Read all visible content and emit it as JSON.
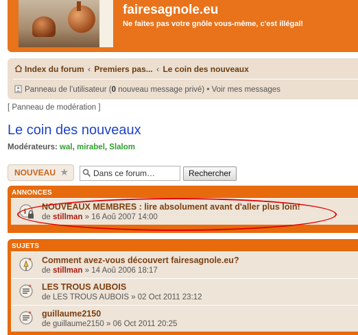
{
  "header": {
    "site_title": "fairesagnole.eu",
    "site_desc": "Ne faites pas votre gnôle vous-même, c'est illégal!"
  },
  "breadcrumbs": {
    "items": [
      "Index du forum",
      "Premiers pas...",
      "Le coin des nouveaux"
    ],
    "separator": "‹"
  },
  "userbar": {
    "panel": "Panneau de l’utilisateur (",
    "count": "0",
    "messages": " nouveau message privé)",
    "dot": "•",
    "view": "Voir mes messages"
  },
  "mod_panel": "[ Panneau de modération ]",
  "forum": {
    "title": "Le coin des nouveaux",
    "moderators_label": "Modérateurs: ",
    "moderators": [
      "wal",
      "mirabel",
      "Slalom"
    ]
  },
  "actions": {
    "new_topic": "NOUVEAU",
    "new_topic_star": "★",
    "search_value": "Dans ce forum…",
    "search_button": "Rechercher"
  },
  "announcements": {
    "header": "ANNONCES",
    "rows": [
      {
        "title": "NOUVEAUX MEMBRES : lire absolument avant d'aller plus loin!",
        "prefix": "de ",
        "author": "stillman",
        "date": " » 16 Aoû 2007 14:00"
      }
    ]
  },
  "topics": {
    "header": "SUJETS",
    "rows": [
      {
        "title": "Comment avez-vous découvert fairesagnole.eu?",
        "prefix": "de ",
        "author": "stillman",
        "date": " » 14 Aoû 2006 18:17"
      },
      {
        "title": "LES TROUS AUBOIS",
        "prefix": "de ",
        "author": "LES TROUS AUBOIS",
        "date": " » 02 Oct 2011 23:12"
      },
      {
        "title": "guillaume2150",
        "prefix": "de ",
        "author": "guillaume2150",
        "date": " » 06 Oct 2011 20:25"
      }
    ]
  },
  "colors": {
    "header_orange": "#e8731b",
    "link_blue": "#1f43c4",
    "moderator_green": "#2ea02e",
    "highlight_red": "#e00000"
  }
}
